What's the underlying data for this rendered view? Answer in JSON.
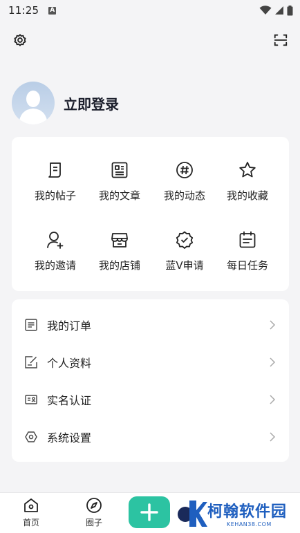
{
  "status_bar": {
    "time": "11:25",
    "notification_glyph": "A"
  },
  "profile": {
    "login_label": "立即登录"
  },
  "grid": [
    {
      "label": "我的帖子",
      "icon": "post-icon"
    },
    {
      "label": "我的文章",
      "icon": "article-icon"
    },
    {
      "label": "我的动态",
      "icon": "hashtag-icon"
    },
    {
      "label": "我的收藏",
      "icon": "star-icon"
    },
    {
      "label": "我的邀请",
      "icon": "invite-user-icon"
    },
    {
      "label": "我的店铺",
      "icon": "store-icon"
    },
    {
      "label": "蓝V申请",
      "icon": "verified-badge-icon"
    },
    {
      "label": "每日任务",
      "icon": "calendar-task-icon"
    }
  ],
  "menu": [
    {
      "label": "我的订单",
      "icon": "order-list-icon"
    },
    {
      "label": "个人资料",
      "icon": "edit-profile-icon"
    },
    {
      "label": "实名认证",
      "icon": "id-card-icon"
    },
    {
      "label": "系统设置",
      "icon": "hexagon-settings-icon"
    }
  ],
  "bottom_nav": [
    {
      "label": "首页",
      "icon": "home-icon"
    },
    {
      "label": "圈子",
      "icon": "compass-icon"
    }
  ],
  "watermark": {
    "brand": "柯翰软件园",
    "domain": "KEHAN38.COM"
  },
  "colors": {
    "accent": "#2cc3a2",
    "background": "#f4f4f6",
    "watermark": "#1f5fbf"
  }
}
